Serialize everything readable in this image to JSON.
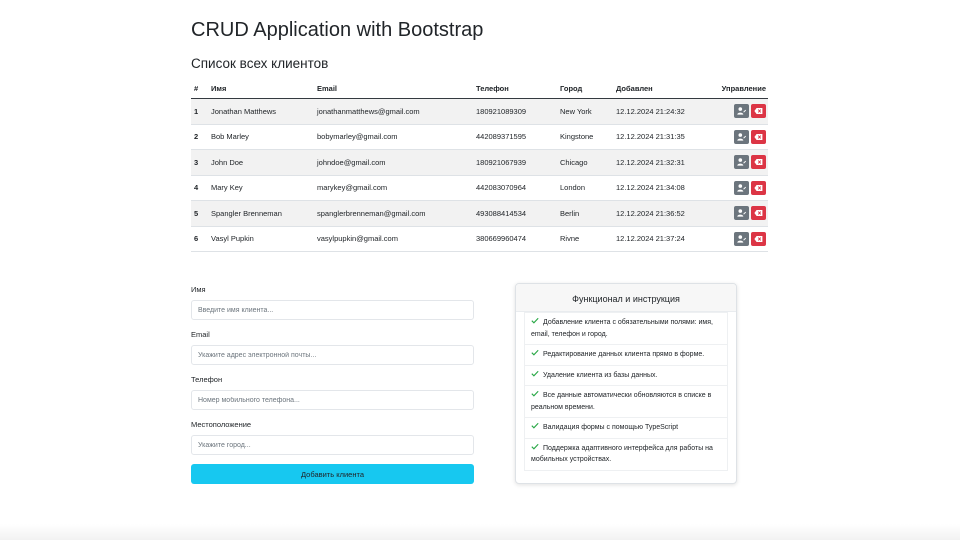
{
  "app_title": "CRUD Application with Bootstrap",
  "list_title": "Список всех клиентов",
  "table": {
    "headers": [
      "#",
      "Имя",
      "Email",
      "Телефон",
      "Город",
      "Добавлен",
      "Управление"
    ],
    "rows": [
      {
        "id": "1",
        "name": "Jonathan Matthews",
        "email": "jonathanmatthews@gmail.com",
        "phone": "180921089309",
        "city": "New York",
        "added": "12.12.2024 21:24:32"
      },
      {
        "id": "2",
        "name": "Bob Marley",
        "email": "bobymarley@gmail.com",
        "phone": "442089371595",
        "city": "Kingstone",
        "added": "12.12.2024 21:31:35"
      },
      {
        "id": "3",
        "name": "John Doe",
        "email": "johndoe@gmail.com",
        "phone": "180921067939",
        "city": "Chicago",
        "added": "12.12.2024 21:32:31"
      },
      {
        "id": "4",
        "name": "Mary Key",
        "email": "marykey@gmail.com",
        "phone": "442083070964",
        "city": "London",
        "added": "12.12.2024 21:34:08"
      },
      {
        "id": "5",
        "name": "Spangler Brenneman",
        "email": "spanglerbrenneman@gmail.com",
        "phone": "493088414534",
        "city": "Berlin",
        "added": "12.12.2024 21:36:52"
      },
      {
        "id": "6",
        "name": "Vasyl Pupkin",
        "email": "vasylpupkin@gmail.com",
        "phone": "380669960474",
        "city": "Rivne",
        "added": "12.12.2024 21:37:24"
      }
    ],
    "edit_icon": "user-edit-icon",
    "delete_icon": "delete-icon",
    "edit_color": "#6c757d",
    "delete_color": "#dc3545"
  },
  "form": {
    "name_label": "Имя",
    "name_placeholder": "Введите имя клиента...",
    "email_label": "Email",
    "email_placeholder": "Укажите адрес электронной почты...",
    "phone_label": "Телефон",
    "phone_placeholder": "Номер мобильного телефона...",
    "location_label": "Местоположение",
    "location_placeholder": "Укажите город...",
    "submit_label": "Добавить клиента",
    "submit_color": "#17c8f0"
  },
  "features": {
    "title": "Функционал и инструкция",
    "icon": "check-icon",
    "items": [
      "Добавление клиента с обязательными полями: имя, email, телефон и город.",
      "Редактирование данных клиента прямо в форме.",
      "Удаление клиента из базы данных.",
      "Все данные автоматически обновляются в списке в реальном времени.",
      "Валидация формы с помощью TypeScript",
      "Поддержка адаптивного интерфейса для работы на мобильных устройствах."
    ]
  }
}
